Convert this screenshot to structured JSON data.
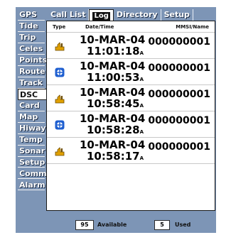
{
  "sidebar": {
    "items": [
      {
        "label": "GPS"
      },
      {
        "label": "Tide"
      },
      {
        "label": "Trip"
      },
      {
        "label": "Celes"
      },
      {
        "label": "Points"
      },
      {
        "label": "Route"
      },
      {
        "label": "Track"
      },
      {
        "label": "DSC",
        "active": true
      },
      {
        "label": "Card"
      },
      {
        "label": "Map"
      },
      {
        "label": "Hiway"
      },
      {
        "label": "Temp"
      },
      {
        "label": "Sonar"
      },
      {
        "label": "Setup"
      },
      {
        "label": "Comm"
      },
      {
        "label": "Alarm"
      }
    ]
  },
  "tabs": {
    "call_list": "Call List",
    "log": "Log",
    "directory": "Directory",
    "setup": "Setup"
  },
  "table": {
    "headers": {
      "type": "Type",
      "date_time": "Date/Time",
      "mmsi_name": "MMSI/Name"
    },
    "rows": [
      {
        "type_icon": "distress-call-icon",
        "date": "10-MAR-04",
        "time": "11:01:18",
        "ampm": "A",
        "mmsi": "000000001"
      },
      {
        "type_icon": "position-report-icon",
        "date": "10-MAR-04",
        "time": "11:00:53",
        "ampm": "A",
        "mmsi": "000000001"
      },
      {
        "type_icon": "distress-call-icon",
        "date": "10-MAR-04",
        "time": "10:58:45",
        "ampm": "A",
        "mmsi": "000000001"
      },
      {
        "type_icon": "position-report-icon",
        "date": "10-MAR-04",
        "time": "10:58:28",
        "ampm": "A",
        "mmsi": "000000001"
      },
      {
        "type_icon": "distress-call-icon",
        "date": "10-MAR-04",
        "time": "10:58:17",
        "ampm": "A",
        "mmsi": "000000001"
      }
    ]
  },
  "footer": {
    "available_count": "95",
    "available_label": "Available",
    "used_count": "5",
    "used_label": "Used"
  },
  "colors": {
    "background": "#7d95b6",
    "panel": "#ffffff",
    "distress_icon": "#e0a000",
    "position_icon": "#1f5fd0"
  }
}
